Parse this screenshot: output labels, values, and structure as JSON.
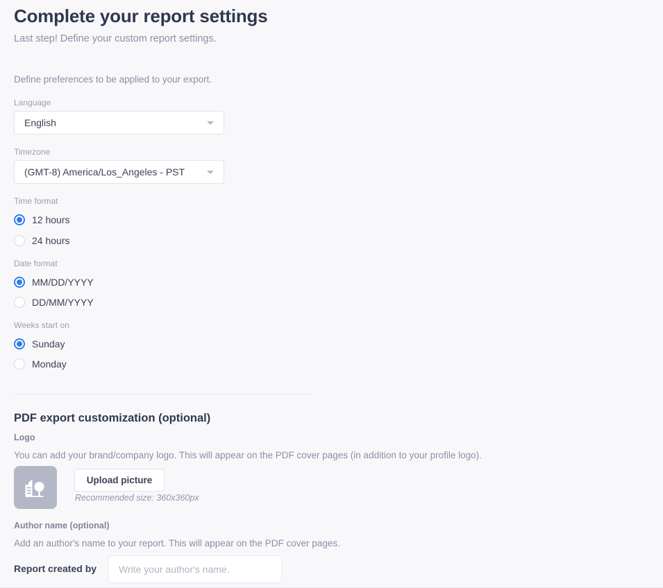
{
  "page": {
    "title": "Complete your report settings",
    "subtitle": "Last step! Define your custom report settings.",
    "intro": "Define preferences to be applied to your export."
  },
  "preferences": {
    "language": {
      "label": "Language",
      "value": "English"
    },
    "timezone": {
      "label": "Timezone",
      "value": "(GMT-8) America/Los_Angeles - PST"
    },
    "time_format": {
      "label": "Time format",
      "options": [
        {
          "label": "12 hours",
          "selected": true
        },
        {
          "label": "24 hours",
          "selected": false
        }
      ]
    },
    "date_format": {
      "label": "Date format",
      "options": [
        {
          "label": "MM/DD/YYYY",
          "selected": true
        },
        {
          "label": "DD/MM/YYYY",
          "selected": false
        }
      ]
    },
    "weeks_start_on": {
      "label": "Weeks start on",
      "options": [
        {
          "label": "Sunday",
          "selected": true
        },
        {
          "label": "Monday",
          "selected": false
        }
      ]
    }
  },
  "pdf_export": {
    "heading": "PDF export customization (optional)",
    "logo": {
      "label": "Logo",
      "description": "You can add your brand/company logo. This will appear on the PDF cover pages (in addition to your profile logo).",
      "upload_button": "Upload picture",
      "recommended_size": "Recommended size: 360x360px"
    },
    "author": {
      "label": "Author name (optional)",
      "description": "Add an author's name to your report. This will appear on the PDF cover pages.",
      "field_label": "Report created by",
      "placeholder": "Write your author's name.",
      "value": ""
    }
  },
  "colors": {
    "background": "#f8f8fb",
    "heading": "#30384f",
    "muted_text": "#8b8fa3",
    "accent": "#2f7ded",
    "border": "#e3e3ea",
    "logo_placeholder": "#b4b8c6"
  }
}
